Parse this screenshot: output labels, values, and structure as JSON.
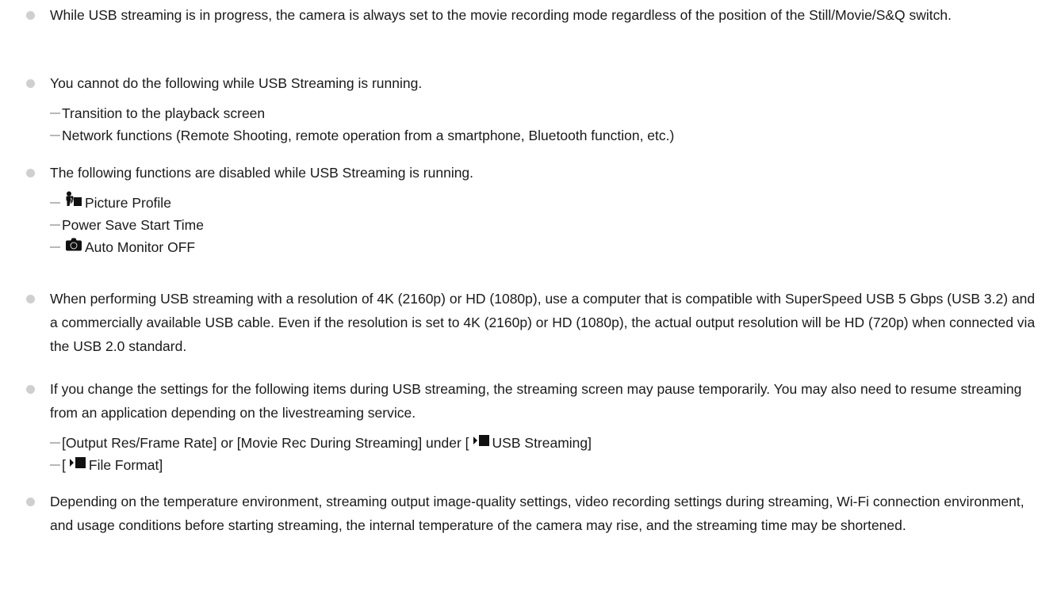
{
  "notes": [
    {
      "text": "While USB streaming is in progress, the camera is always set to the movie recording mode regardless of the position of the Still/Movie/S&Q switch."
    },
    {
      "text": "You cannot do the following while USB Streaming is running.",
      "items": [
        "Transition to the playback screen",
        "Network functions (Remote Shooting, remote operation from a smartphone, Bluetooth function, etc.)"
      ]
    },
    {
      "text": "The following functions are disabled while USB Streaming is running.",
      "items": [
        "Picture Profile",
        "Power Save Start Time",
        "Auto Monitor OFF"
      ]
    },
    {
      "text": "When performing USB streaming with a resolution of 4K (2160p) or HD (1080p), use a computer that is compatible with SuperSpeed USB 5 Gbps (USB 3.2) and a commercially available USB cable. Even if the resolution is set to 4K (2160p) or HD (1080p), the actual output resolution will be HD (720p) when connected via the USB 2.0 standard."
    },
    {
      "text": "If you change the settings for the following items during USB streaming, the streaming screen may pause temporarily. You may also need to resume streaming from an application depending on the livestreaming service.",
      "items": [
        {
          "before": "[Output Res/Frame Rate] or [Movie Rec During Streaming] under [",
          "after": "USB Streaming]"
        },
        {
          "before": "[",
          "after": "File Format]"
        }
      ]
    },
    {
      "text": "Depending on the temperature environment, streaming output image-quality settings, video recording settings during streaming, Wi-Fi connection environment, and usage conditions before starting streaming, the internal temperature of the camera may rise, and the streaming time may be shortened."
    }
  ],
  "icons": {
    "picture_profile": "picture-profile-icon",
    "camera": "camera-icon",
    "movie": "movie-icon",
    "bullet": "bullet-dot-icon",
    "dash": "dash-icon"
  },
  "colors": {
    "text": "#1a1a1a",
    "bullet": "#cfcfcf",
    "dash": "#b8b8b8"
  }
}
